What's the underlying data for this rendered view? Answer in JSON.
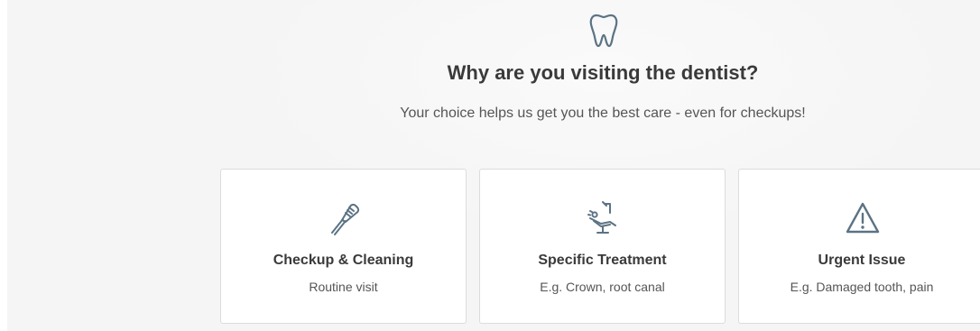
{
  "heading": {
    "icon": "tooth-icon",
    "title": "Why are you visiting the dentist?",
    "subtitle": "Your choice helps us get you the best care - even for checkups!"
  },
  "options": [
    {
      "icon": "toothbrush-icon",
      "title": "Checkup & Cleaning",
      "subtitle": "Routine visit"
    },
    {
      "icon": "dental-chair-icon",
      "title": "Specific Treatment",
      "subtitle": "E.g. Crown, root canal"
    },
    {
      "icon": "warning-icon",
      "title": "Urgent Issue",
      "subtitle": "E.g. Damaged tooth, pain"
    }
  ],
  "colors": {
    "background": "#f5f5f5",
    "card": "#ffffff",
    "card_border": "#dcdcdc",
    "icon": "#5b7384",
    "text": "#3a3a3a"
  }
}
